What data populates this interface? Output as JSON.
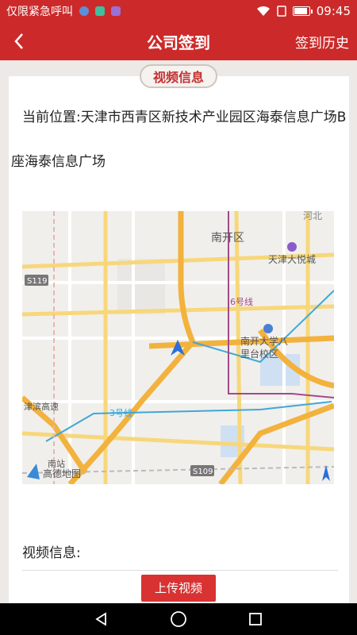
{
  "status_bar": {
    "carrier": "仅限紧急呼叫",
    "time": "09:45",
    "battery_percent": 80,
    "icon_colors": [
      "#5b8fd9",
      "#3fbf9f",
      "#9b6fd6"
    ]
  },
  "header": {
    "title": "公司签到",
    "history_label": "签到历史",
    "background": "#cc2a2a"
  },
  "section_tag": "视频信息",
  "location": {
    "label": "当前位置:",
    "address": "天津市西青区新技术产业园区海泰信息广场B座海泰信息广场"
  },
  "map": {
    "labels": {
      "district": "南开区",
      "mall": "天津大悦城",
      "campus_line1": "南开大学八",
      "campus_line2": "里台校区",
      "metro3": "3号线",
      "metro6": "6号线",
      "road_s119": "S119",
      "road_s109": "S109",
      "top_left_text": "河北",
      "left_edge_text": "津滨高速",
      "logo_text": "高德地图",
      "place_nan": "南站"
    }
  },
  "video": {
    "label": "视频信息:",
    "upload_label": "上传视频"
  }
}
